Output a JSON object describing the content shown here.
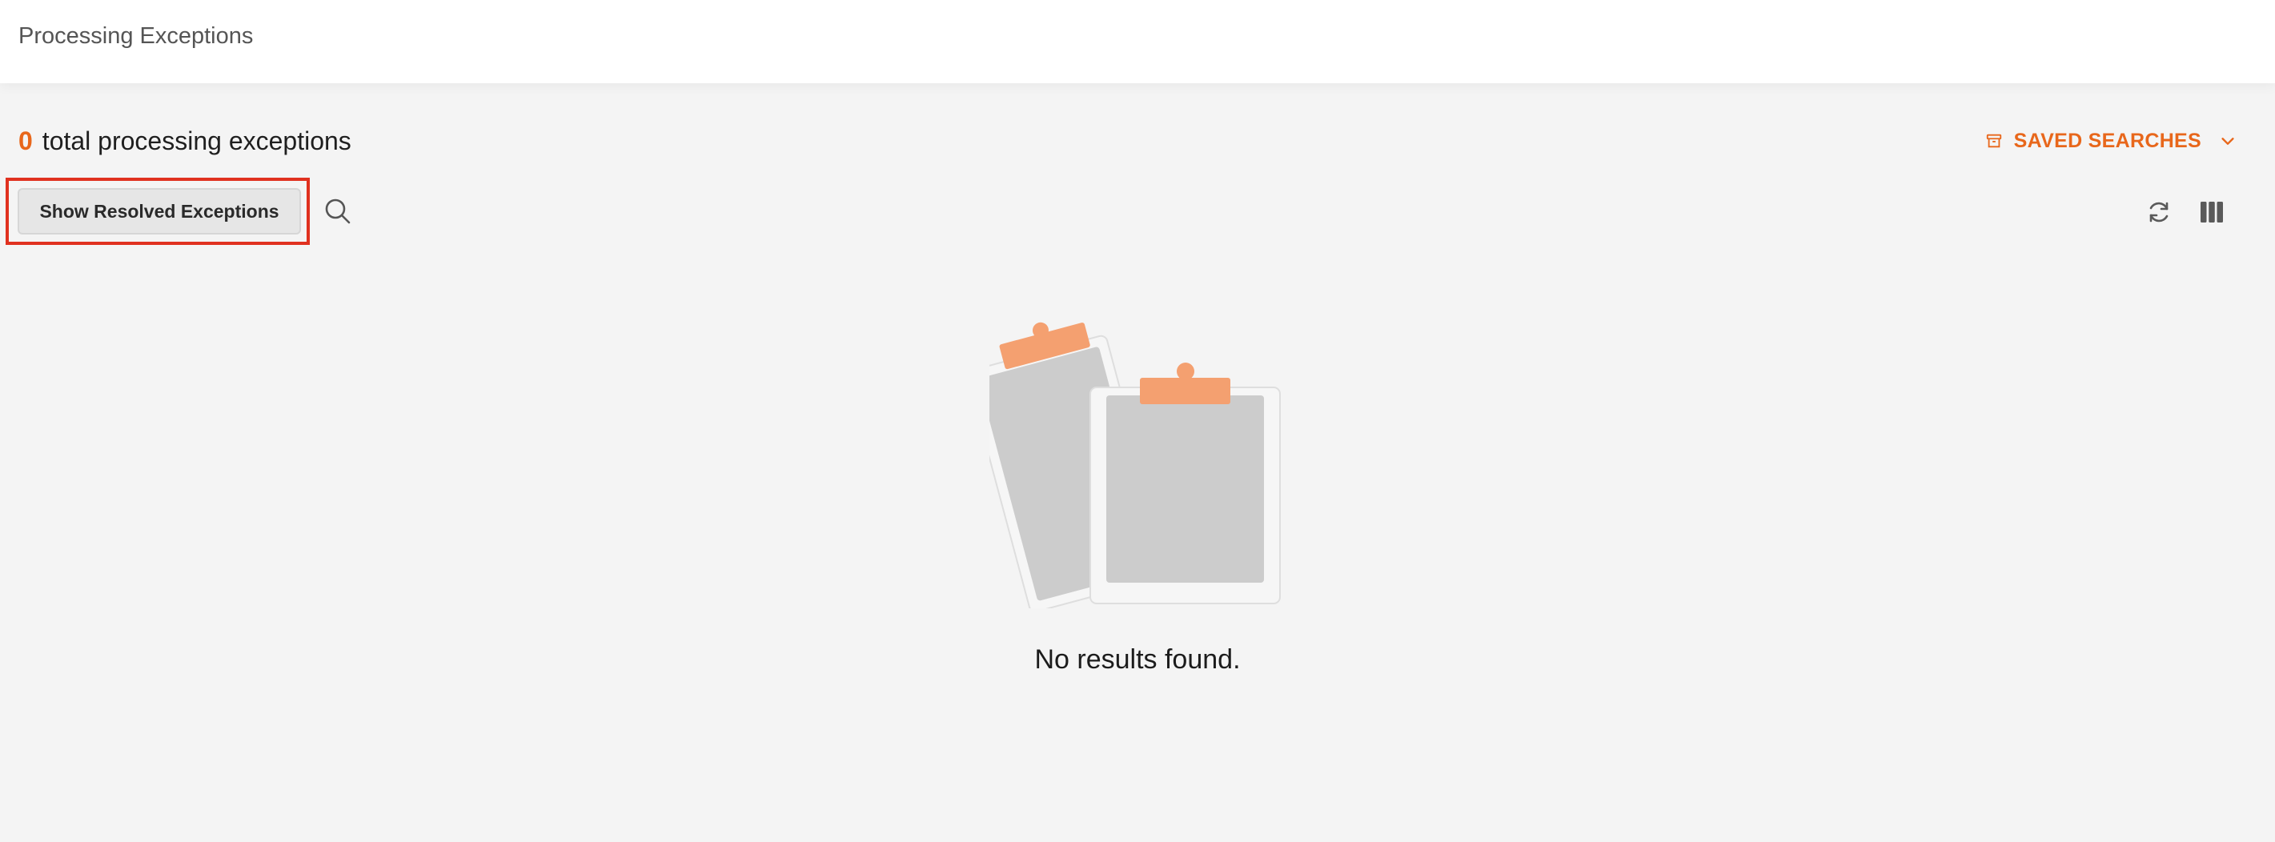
{
  "header": {
    "title": "Processing Exceptions"
  },
  "summary": {
    "count": "0",
    "label": "total processing exceptions"
  },
  "saved_searches": {
    "label": "SAVED SEARCHES",
    "icon": "archive-icon",
    "dropdown_icon": "chevron-down-icon"
  },
  "toolbar": {
    "show_resolved_label": "Show Resolved Exceptions",
    "search_icon": "search-icon",
    "refresh_icon": "refresh-icon",
    "columns_icon": "columns-icon"
  },
  "empty_state": {
    "message": "No results found.",
    "illustration": "clipboards-illustration"
  },
  "colors": {
    "accent": "#e8671b",
    "highlight": "#e0311f",
    "clip": "#f4a070",
    "clipboard_fill": "#cccccc",
    "background": "#f4f4f4"
  }
}
